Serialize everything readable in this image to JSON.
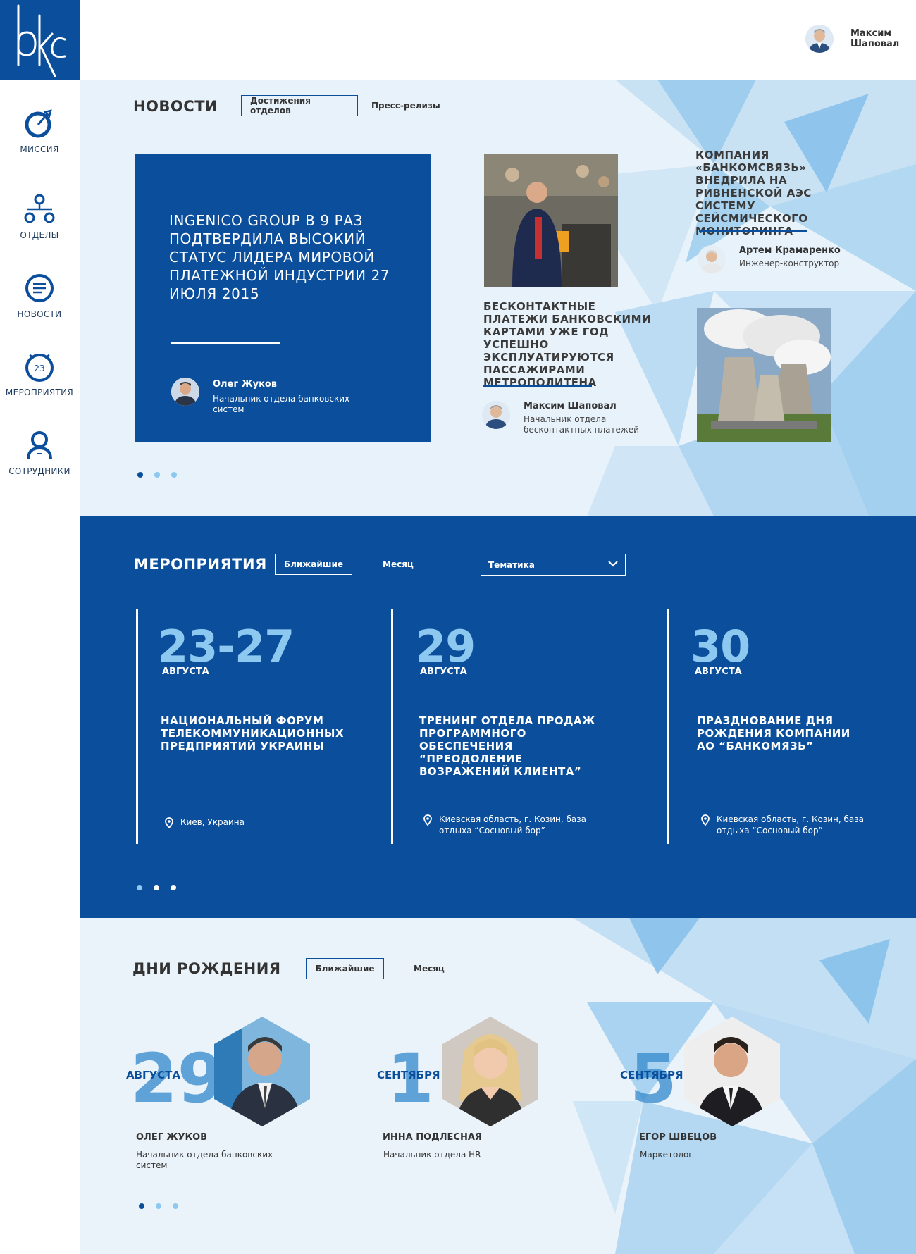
{
  "brand": {
    "logo_text": "bkc",
    "primary": "#0b4f9c",
    "accent": "#8cc8f0"
  },
  "sidebar": {
    "items": [
      {
        "label": "МИССИЯ",
        "icon": "target-icon"
      },
      {
        "label": "ОТДЕЛЫ",
        "icon": "structure-icon"
      },
      {
        "label": "НОВОСТИ",
        "icon": "news-icon"
      },
      {
        "label": "МЕРОПРИЯТИЯ",
        "icon": "calendar-icon",
        "badge": "23"
      },
      {
        "label": "СОТРУДНИКИ",
        "icon": "person-icon"
      }
    ]
  },
  "header": {
    "user_name": "Максим Шаповал"
  },
  "news": {
    "title": "НОВОСТИ",
    "tabs": [
      "Достижения отделов",
      "Пресс-релизы"
    ],
    "featured": {
      "title": "INGENICO GROUP В 9 РАЗ ПОДТВЕРДИЛА ВЫСОКИЙ СТАТУС ЛИДЕРА МИРОВОЙ ПЛАТЕЖНОЙ ИНДУСТРИИ 27 ИЮЛЯ 2015",
      "author": "Олег Жуков",
      "role": "Начальник отдела банковских систем"
    },
    "item1": {
      "title": "БЕСКОНТАКТНЫЕ ПЛАТЕЖИ БАНКОВСКИМИ КАРТАМИ УЖЕ ГОД УСПЕШНО ЭКСПЛУАТИРУЮТСЯ ПАССАЖИРАМИ МЕТРОПОЛИТЕНА",
      "author": "Максим Шаповал",
      "role": "Начальник отдела бесконтактных платежей"
    },
    "item2": {
      "title": "КОМПАНИЯ «БАНКОМСВЯЗЬ» ВНЕДРИЛА НА РИВНЕНСКОЙ АЭС СИСТЕМУ СЕЙСМИЧЕСКОГО МОНИТОРИНГА",
      "author": "Артем Крамаренко",
      "role": "Инженер-конструктор"
    }
  },
  "events": {
    "title": "МЕРОПРИЯТИЯ",
    "tabs": [
      "Ближайшие",
      "Месяц"
    ],
    "select_value": "Тематика",
    "items": [
      {
        "date": "23-27",
        "month": "АВГУСТА",
        "name": "НАЦИОНАЛЬНЫЙ ФОРУМ ТЕЛЕКОММУНИКАЦИОННЫХ ПРЕДПРИЯТИЙ УКРАИНЫ",
        "location": "Киев, Украина"
      },
      {
        "date": "29",
        "month": "АВГУСТА",
        "name": "ТРЕНИНГ ОТДЕЛА ПРОДАЖ ПРОГРАММНОГО ОБЕСПЕЧЕНИЯ “ПРЕОДОЛЕНИЕ ВОЗРАЖЕНИЙ КЛИЕНТА”",
        "location": "Киевская область, г. Козин, база отдыха “Сосновый бор”"
      },
      {
        "date": "30",
        "month": "АВГУСТА",
        "name": "ПРАЗДНОВАНИЕ ДНЯ РОЖДЕНИЯ КОМПАНИИ АО “БАНКОМЯЗЬ”",
        "location": "Киевская область, г. Козин, база отдыха “Сосновый бор”"
      }
    ]
  },
  "birthdays": {
    "title": "ДНИ РОЖДЕНИЯ",
    "tabs": [
      "Ближайшие",
      "Месяц"
    ],
    "items": [
      {
        "day": "29",
        "month": "АВГУСТА",
        "name": "ОЛЕГ ЖУКОВ",
        "role": "Начальник отдела банковских систем"
      },
      {
        "day": "1",
        "month": "СЕНТЯБРЯ",
        "name": "ИННА ПОДЛЕСНАЯ",
        "role": "Начальник отдела HR"
      },
      {
        "day": "5",
        "month": "СЕНТЯБРЯ",
        "name": "ЕГОР ШВЕЦОВ",
        "role": "Маркетолог"
      }
    ]
  }
}
